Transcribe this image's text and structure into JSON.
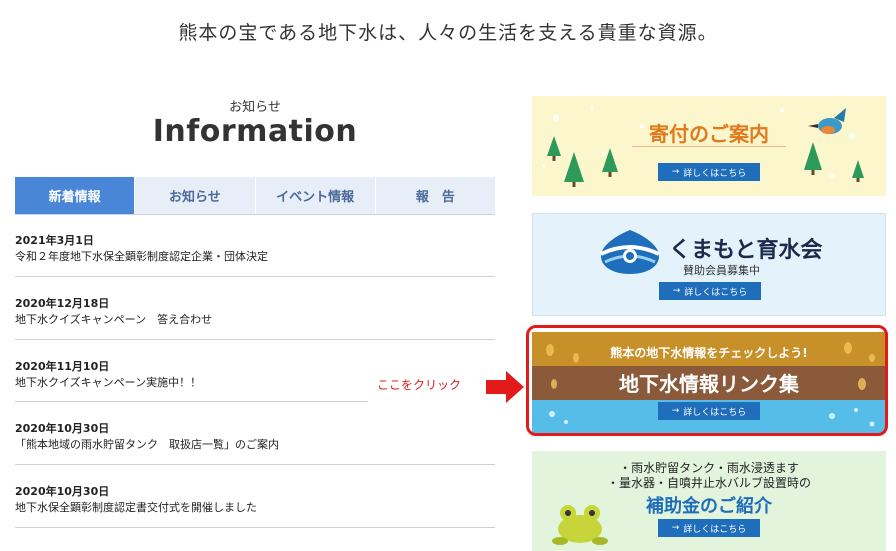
{
  "header": {
    "tagline": "熊本の宝である地下水は、人々の生活を支える貴重な資源。"
  },
  "info": {
    "subtitle": "お知らせ",
    "title": "Information",
    "tabs": [
      "新着情報",
      "お知らせ",
      "イベント情報",
      "報　告"
    ],
    "news": [
      {
        "date": "2021年3月1日",
        "title": "令和２年度地下水保全顕彰制度認定企業・団体決定"
      },
      {
        "date": "2020年12月18日",
        "title": "地下水クイズキャンペーン　答え合わせ"
      },
      {
        "date": "2020年11月10日",
        "title": "地下水クイズキャンペーン実施中！！"
      },
      {
        "date": "2020年10月30日",
        "title": "「熊本地域の雨水貯留タンク　取扱店一覧」のご案内"
      },
      {
        "date": "2020年10月30日",
        "title": "地下水保全顕彰制度認定書交付式を開催しました"
      }
    ]
  },
  "banners": {
    "more_label": "詳しくはこちら",
    "donation": {
      "title": "寄付のご案内"
    },
    "ikusuikai": {
      "title": "くまもと育水会",
      "subtitle": "賛助会員募集中"
    },
    "links": {
      "top": "熊本の地下水情報をチェックしよう!",
      "title": "地下水情報リンク集"
    },
    "subsidy": {
      "line1": "・雨水貯留タンク・雨水浸透ます",
      "line2": "・量水器・自噴井止水バルブ設置時の",
      "title": "補助金のご紹介"
    }
  },
  "annotation": {
    "label": "ここをクリック"
  },
  "colors": {
    "tab_active": "#4a86d8",
    "button": "#1f6ebc",
    "highlight": "#e21a1a"
  }
}
